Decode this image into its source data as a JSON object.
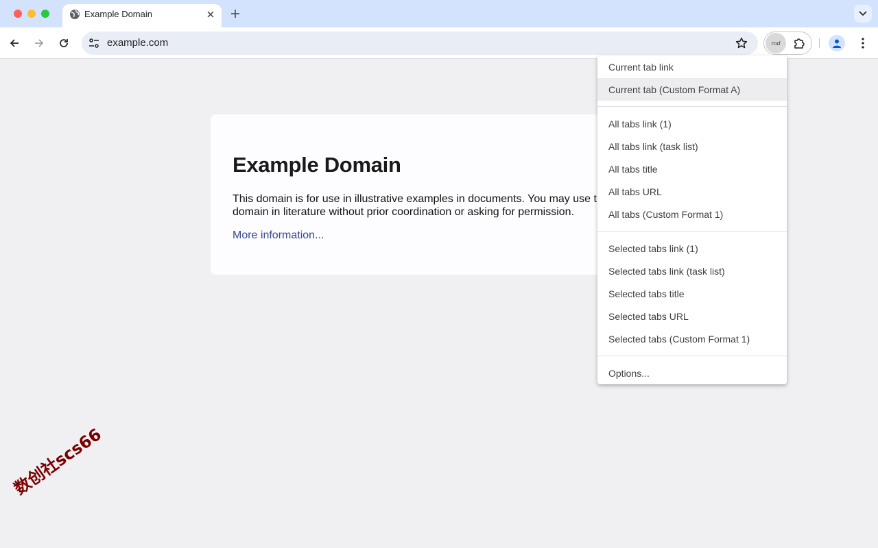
{
  "window": {
    "controls": [
      "close",
      "minimize",
      "maximize"
    ]
  },
  "tab": {
    "title": "Example Domain",
    "icon": "globe-icon"
  },
  "toolbar": {
    "url": "example.com",
    "extension_badge": "md"
  },
  "page": {
    "heading": "Example Domain",
    "body": "This domain is for use in illustrative examples in documents. You may use this domain in literature without prior coordination or asking for permission.",
    "link": "More information..."
  },
  "menu": {
    "groups": [
      {
        "items": [
          "Current tab link",
          "Current tab (Custom Format A)"
        ]
      },
      {
        "items": [
          "All tabs link (1)",
          "All tabs link (task list)",
          "All tabs title",
          "All tabs URL",
          "All tabs (Custom Format 1)"
        ]
      },
      {
        "items": [
          "Selected tabs link (1)",
          "Selected tabs link (task list)",
          "Selected tabs title",
          "Selected tabs URL",
          "Selected tabs (Custom Format 1)"
        ]
      },
      {
        "items": [
          "Options..."
        ]
      }
    ],
    "highlighted": "Current tab (Custom Format A)"
  },
  "watermark": "数创社scs66",
  "colors": {
    "tabstrip": "#d3e3fd",
    "omnibox": "#e9eef6",
    "link": "#38488f",
    "page_bg": "#f0f0f2"
  }
}
